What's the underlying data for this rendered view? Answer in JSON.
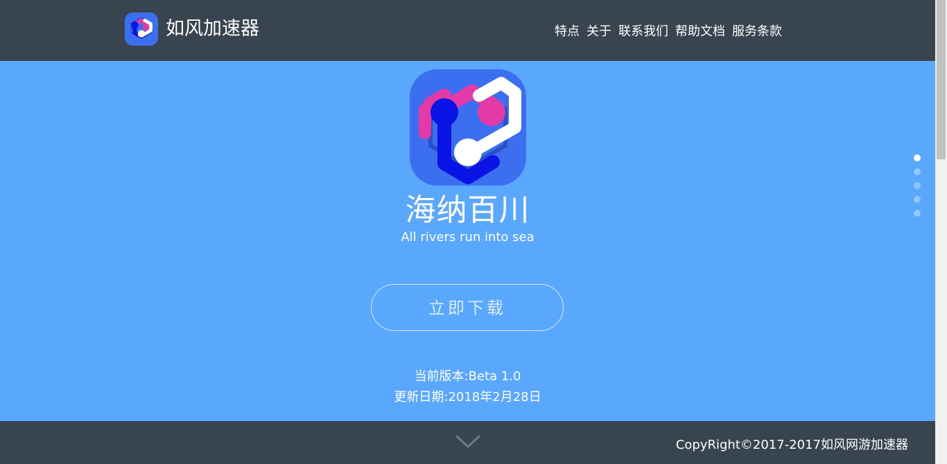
{
  "header": {
    "brand_name": "如风加速器",
    "logo_icon": "app-logo-icon",
    "nav": [
      {
        "label": "特点"
      },
      {
        "label": "关于"
      },
      {
        "label": "联系我们"
      },
      {
        "label": "帮助文档"
      },
      {
        "label": "服务条款"
      }
    ]
  },
  "hero": {
    "slogan": "海纳百川",
    "slogan_en": "All rivers run into sea",
    "download_label": "立即下载",
    "version": "当前版本:Beta 1.0",
    "update_date": "更新日期:2018年2月28日",
    "active_section": 1,
    "section_count": 5
  },
  "footer": {
    "copyright": "CopyRight©2017-2017如风网游加速器",
    "scroll_icon": "chevron-down-icon"
  },
  "colors": {
    "header_bg": "#38444f",
    "hero_bg": "#5aa8fd",
    "logo_bg": "#3b6ff0",
    "logo_pink": "#e43aa8",
    "logo_navy": "#0a14e6",
    "text": "#ffffff"
  }
}
